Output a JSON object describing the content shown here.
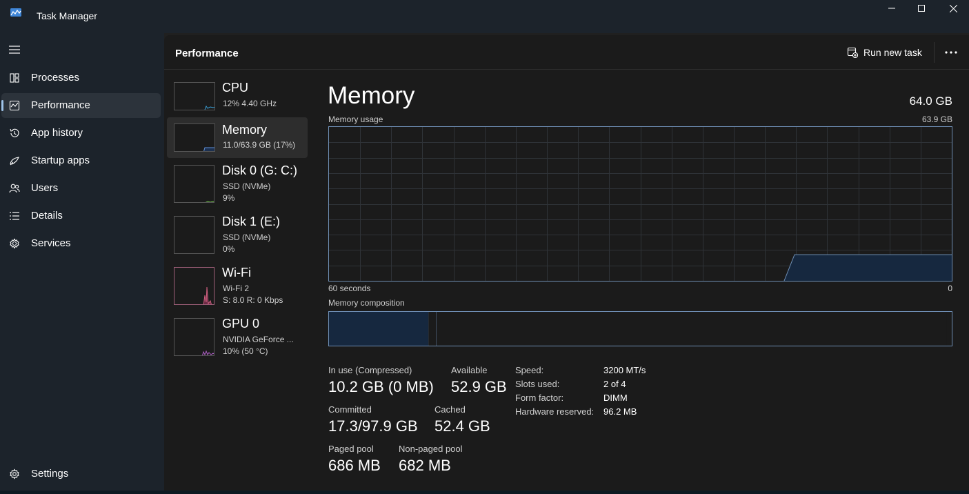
{
  "window": {
    "title": "Task Manager",
    "controls": [
      "minimize",
      "maximize",
      "close"
    ]
  },
  "nav": {
    "items": [
      {
        "label": "Processes",
        "icon": "processes-icon"
      },
      {
        "label": "Performance",
        "icon": "performance-icon",
        "selected": true
      },
      {
        "label": "App history",
        "icon": "history-icon"
      },
      {
        "label": "Startup apps",
        "icon": "startup-icon"
      },
      {
        "label": "Users",
        "icon": "users-icon"
      },
      {
        "label": "Details",
        "icon": "details-icon"
      },
      {
        "label": "Services",
        "icon": "services-icon"
      }
    ],
    "settings_label": "Settings"
  },
  "header": {
    "title": "Performance",
    "run_new_task": "Run new task"
  },
  "devices": [
    {
      "name": "CPU",
      "line1": "12%  4.40 GHz",
      "line2": "",
      "graph_color": "#3aa0d8"
    },
    {
      "name": "Memory",
      "line1": "11.0/63.9 GB (17%)",
      "line2": "",
      "graph_color": "#5f8fd6",
      "selected": true
    },
    {
      "name": "Disk 0 (G: C:)",
      "line1": "SSD (NVMe)",
      "line2": "9%",
      "graph_color": "#6fbf4a"
    },
    {
      "name": "Disk 1 (E:)",
      "line1": "SSD (NVMe)",
      "line2": "0%",
      "graph_color": "#6fbf4a"
    },
    {
      "name": "Wi-Fi",
      "line1": "Wi-Fi 2",
      "line2": "S: 8.0  R: 0 Kbps",
      "graph_color": "#d06080"
    },
    {
      "name": "GPU 0",
      "line1": "NVIDIA GeForce ...",
      "line2": "10%  (50 °C)",
      "graph_color": "#b060c8"
    }
  ],
  "detail": {
    "title": "Memory",
    "total": "64.0 GB",
    "usage_label": "Memory usage",
    "usage_max": "63.9 GB",
    "time_left": "60 seconds",
    "time_right": "0",
    "composition_label": "Memory composition",
    "accent": "#6f8fb5",
    "usage_fraction": 0.17,
    "composition": {
      "in_use_gb": 10.2,
      "modified_gb": 0.8,
      "standby_gb": 52.4,
      "free_gb": 0.5
    },
    "stats": {
      "in_use_label": "In use (Compressed)",
      "in_use_value": "10.2 GB (0 MB)",
      "available_label": "Available",
      "available_value": "52.9 GB",
      "committed_label": "Committed",
      "committed_value": "17.3/97.9 GB",
      "cached_label": "Cached",
      "cached_value": "52.4 GB",
      "paged_label": "Paged pool",
      "paged_value": "686 MB",
      "nonpaged_label": "Non-paged pool",
      "nonpaged_value": "682 MB"
    },
    "specs": [
      {
        "label": "Speed:",
        "value": "3200 MT/s"
      },
      {
        "label": "Slots used:",
        "value": "2 of 4"
      },
      {
        "label": "Form factor:",
        "value": "DIMM"
      },
      {
        "label": "Hardware reserved:",
        "value": "96.2 MB"
      }
    ]
  }
}
